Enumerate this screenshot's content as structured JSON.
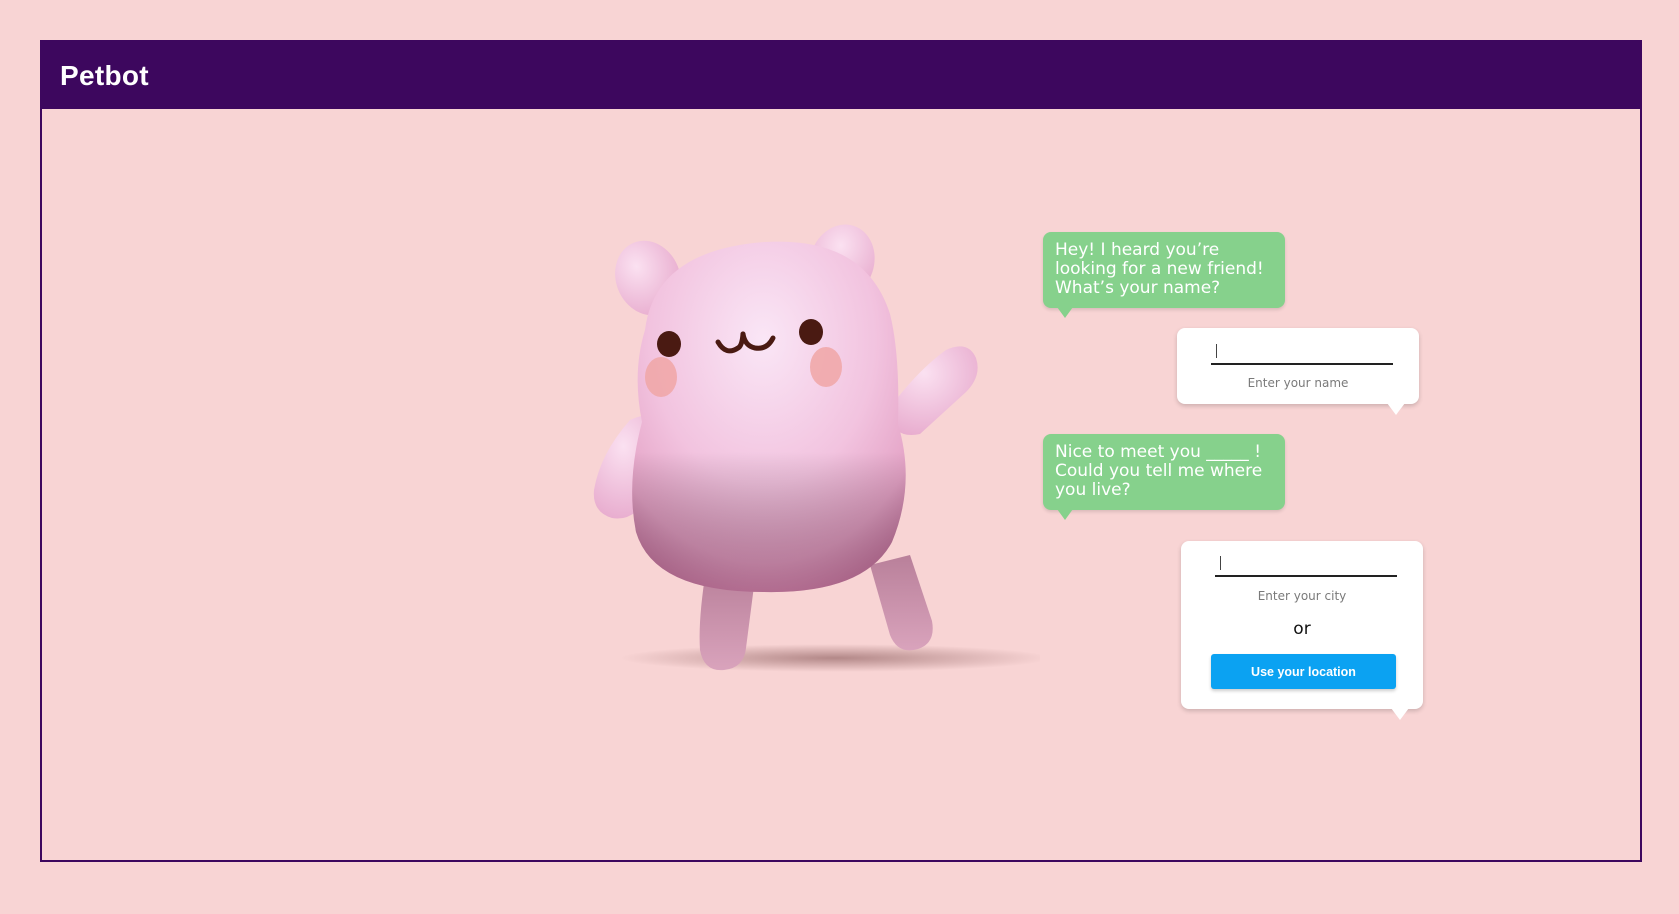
{
  "app": {
    "title": "Petbot"
  },
  "colors": {
    "header": "#3d075e",
    "background": "#f8d4d4",
    "bot_bubble": "#86d18c",
    "button": "#0ba2f2"
  },
  "conversation": {
    "bot_message_1": "Hey! I heard you’re looking for a new friend! What’s your name?",
    "name_input": {
      "value": "",
      "hint": "Enter your name"
    },
    "bot_message_2": "Nice to meet you _____ ! Could you tell me where you live?",
    "city_input": {
      "value": "",
      "hint": "Enter your city"
    },
    "or_text": "or",
    "location_button_label": "Use your location"
  },
  "mascot": {
    "icon": "pink-hamster-mascot"
  }
}
